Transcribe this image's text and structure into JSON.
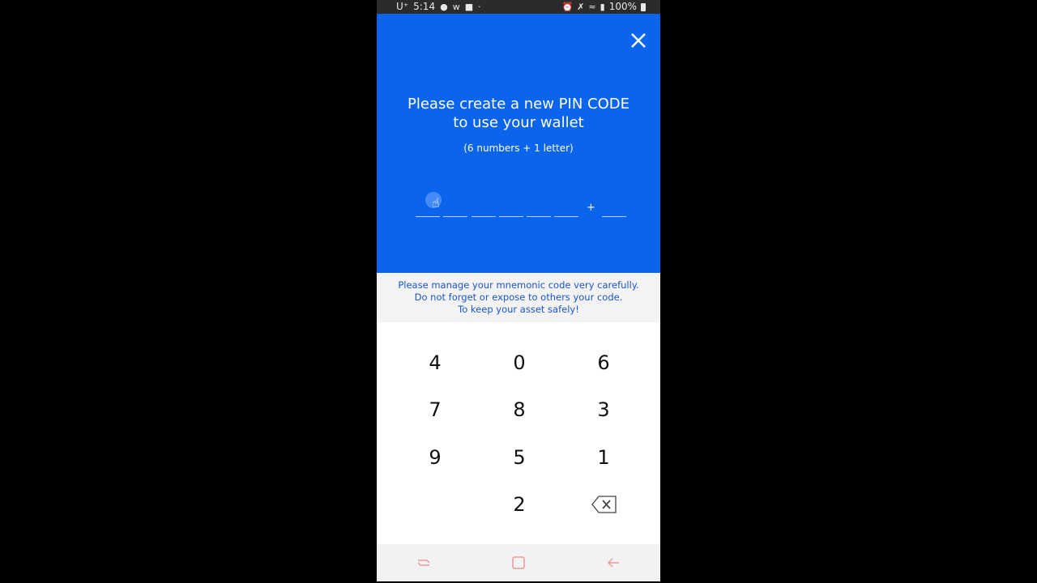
{
  "status_bar": {
    "carrier": "U⁺",
    "time": "5:14",
    "battery_text": "100%"
  },
  "header": {
    "title_line1": "Please create a new PIN CODE",
    "title_line2": "to use your wallet",
    "subtitle": "(6 numbers + 1 letter)",
    "pin_separator": "+",
    "close_icon": "close-icon",
    "bg_color": "#0a64ec"
  },
  "notice": {
    "line1": "Please manage your mnemonic code very carefully.",
    "line2": "Do not forget or expose to others your code.",
    "line3": "To keep your asset safely!",
    "color": "#1a56c9"
  },
  "keypad": {
    "keys": [
      "4",
      "0",
      "6",
      "7",
      "8",
      "3",
      "9",
      "5",
      "1",
      "2"
    ],
    "backspace_icon": "backspace-icon"
  },
  "nav_bar": {
    "recent_icon": "recent-apps-icon",
    "home_icon": "home-icon",
    "back_icon": "back-icon"
  }
}
